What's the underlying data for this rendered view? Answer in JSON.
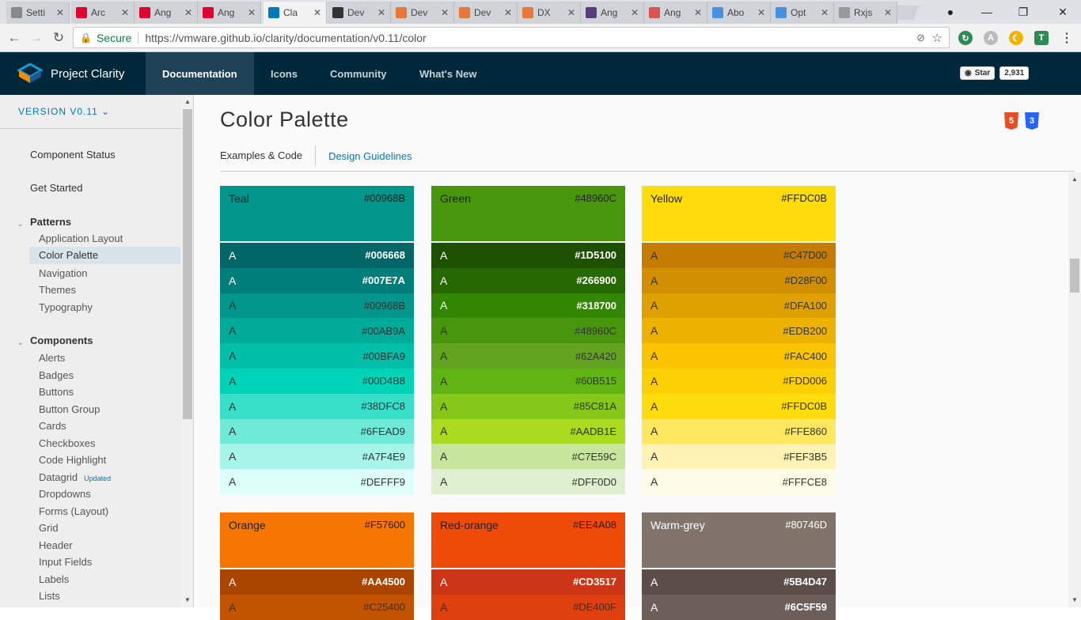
{
  "browser": {
    "tabs": [
      {
        "label": "Setti",
        "favicon": "gear-icon",
        "color": "#888"
      },
      {
        "label": "Arc",
        "favicon": "angular-icon",
        "color": "#dd0031"
      },
      {
        "label": "Ang",
        "favicon": "angular-icon",
        "color": "#dd0031"
      },
      {
        "label": "Ang",
        "favicon": "angular-icon",
        "color": "#dd0031"
      },
      {
        "label": "Cla",
        "favicon": "clarity-icon",
        "color": "#0079b8"
      },
      {
        "label": "Dev",
        "favicon": "github-icon",
        "color": "#333"
      },
      {
        "label": "Dev",
        "favicon": "slides-icon",
        "color": "#e8773a"
      },
      {
        "label": "Dev",
        "favicon": "slides-icon",
        "color": "#e8773a"
      },
      {
        "label": "DX",
        "favicon": "slides-icon",
        "color": "#e8773a"
      },
      {
        "label": "Ang",
        "favicon": "bootstrap-icon",
        "color": "#563d7c"
      },
      {
        "label": "Ang",
        "favicon": "bootstrap-icon",
        "color": "#d9534f"
      },
      {
        "label": "Abo",
        "favicon": "stack-icon",
        "color": "#4a90e2"
      },
      {
        "label": "Opt",
        "favicon": "stack-icon",
        "color": "#4a90e2"
      },
      {
        "label": "Rxjs",
        "favicon": "page-icon",
        "color": "#999"
      }
    ],
    "secure_label": "Secure",
    "url": "https://vmware.github.io/clarity/documentation/v0.11/color"
  },
  "header": {
    "brand": "Project Clarity",
    "nav": [
      "Documentation",
      "Icons",
      "Community",
      "What's New"
    ],
    "github_star": "Star",
    "github_count": "2,931"
  },
  "sidebar": {
    "version": "VERSION V0.11",
    "component_status": "Component Status",
    "get_started": "Get Started",
    "patterns_label": "Patterns",
    "patterns": [
      "Application Layout",
      "Color Palette",
      "Navigation",
      "Themes",
      "Typography"
    ],
    "components_label": "Components",
    "components": [
      "Alerts",
      "Badges",
      "Buttons",
      "Button Group",
      "Cards",
      "Checkboxes",
      "Code Highlight",
      "Datagrid",
      "Dropdowns",
      "Forms (Layout)",
      "Grid",
      "Header",
      "Input Fields",
      "Labels",
      "Lists"
    ],
    "updated_badge": "Updated"
  },
  "page": {
    "title": "Color Palette",
    "tab_examples": "Examples & Code",
    "tab_guidelines": "Design Guidelines"
  },
  "palettes": [
    {
      "name": "Teal",
      "hex": "#00968B",
      "head_text": "dark",
      "rows": [
        [
          "#006668",
          "w",
          true
        ],
        [
          "#007E7A",
          "w",
          true
        ],
        [
          "#00968B",
          "d",
          false
        ],
        [
          "#00AB9A",
          "d",
          false
        ],
        [
          "#00BFA9",
          "d",
          false
        ],
        [
          "#00D4B8",
          "d",
          false
        ],
        [
          "#38DFC8",
          "d",
          false
        ],
        [
          "#6FEAD9",
          "d",
          false
        ],
        [
          "#A7F4E9",
          "d",
          false
        ],
        [
          "#DEFFF9",
          "d",
          false
        ]
      ]
    },
    {
      "name": "Green",
      "hex": "#48960C",
      "head_text": "dark",
      "rows": [
        [
          "#1D5100",
          "w",
          true
        ],
        [
          "#266900",
          "w",
          true
        ],
        [
          "#318700",
          "w",
          true
        ],
        [
          "#48960C",
          "d",
          false
        ],
        [
          "#62A420",
          "d",
          false
        ],
        [
          "#60B515",
          "d",
          false
        ],
        [
          "#85C81A",
          "d",
          false
        ],
        [
          "#AADB1E",
          "d",
          false
        ],
        [
          "#C7E59C",
          "d",
          false
        ],
        [
          "#DFF0D0",
          "d",
          false
        ]
      ]
    },
    {
      "name": "Yellow",
      "hex": "#FFDC0B",
      "head_text": "dark",
      "rows": [
        [
          "#C47D00",
          "d",
          false
        ],
        [
          "#D28F00",
          "d",
          false
        ],
        [
          "#DFA100",
          "d",
          false
        ],
        [
          "#EDB200",
          "d",
          false
        ],
        [
          "#FAC400",
          "d",
          false
        ],
        [
          "#FDD006",
          "d",
          false
        ],
        [
          "#FFDC0B",
          "d",
          false
        ],
        [
          "#FFE860",
          "d",
          false
        ],
        [
          "#FEF3B5",
          "d",
          false
        ],
        [
          "#FFFCE8",
          "d",
          false
        ]
      ]
    },
    {
      "name": "Orange",
      "hex": "#F57600",
      "head_text": "dark",
      "rows": [
        [
          "#AA4500",
          "w",
          true
        ],
        [
          "#C25400",
          "d",
          false
        ]
      ]
    },
    {
      "name": "Red-orange",
      "hex": "#EE4A08",
      "head_text": "dark",
      "rows": [
        [
          "#CD3517",
          "w",
          true
        ],
        [
          "#DE400F",
          "d",
          false
        ]
      ]
    },
    {
      "name": "Warm-grey",
      "hex": "#80746D",
      "head_text": "light",
      "rows": [
        [
          "#5B4D47",
          "w",
          true
        ],
        [
          "#6C5F59",
          "w",
          true
        ]
      ]
    }
  ],
  "row_letter": "A"
}
